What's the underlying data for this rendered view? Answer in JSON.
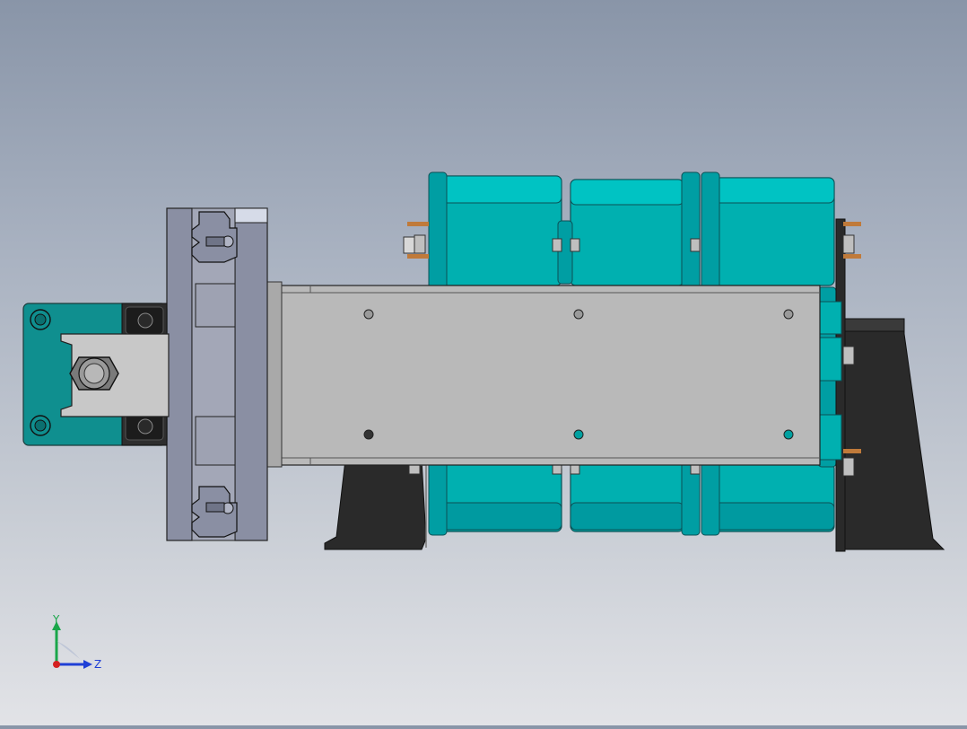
{
  "viewport": {
    "background_top": "#8995a8",
    "background_bottom": "#e2e3e7"
  },
  "model": {
    "colors": {
      "teal": "#00b0b0",
      "teal_dark": "#008f95",
      "steel": "#b9b9b9",
      "frame_gray": "#8a8fa3",
      "bracket_black": "#2a2a2a",
      "bolt_copper": "#c07a3a"
    }
  },
  "triad": {
    "x_label": "Z",
    "y_label": "Y",
    "x_color": "#1f3fd6",
    "y_color": "#1aa64a",
    "origin_color": "#d42020"
  }
}
